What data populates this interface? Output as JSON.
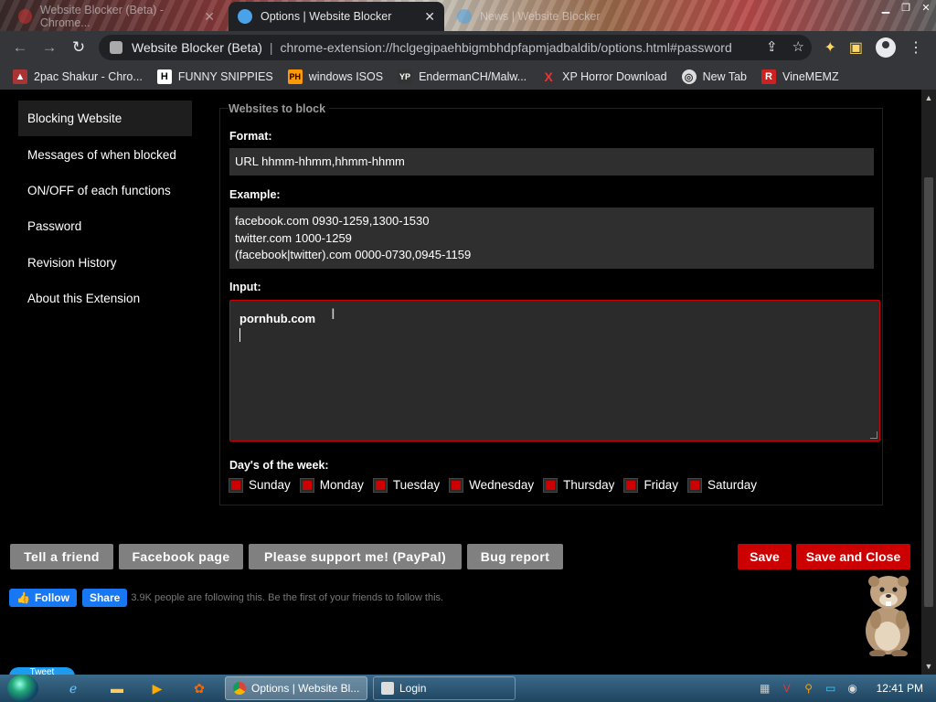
{
  "browser": {
    "tabs": [
      {
        "title": "Website Blocker (Beta) - Chrome...",
        "active": false
      },
      {
        "title": "Options | Website Blocker",
        "active": true
      },
      {
        "title": "News | Website Blocker",
        "active": false
      }
    ],
    "omnibox": {
      "site_name": "Website Blocker (Beta)",
      "separator": "|",
      "url": "chrome-extension://hclgegipaehbigmbhdpfapmjadbaldib/options.html#password"
    },
    "bookmarks": [
      {
        "label": "2pac Shakur - Chro...",
        "icon": "2pac-icon"
      },
      {
        "label": "FUNNY SNIPPIES",
        "icon": "H"
      },
      {
        "label": "windows ISOS",
        "icon": "PH"
      },
      {
        "label": "EndermanCH/Malw...",
        "icon": "YP"
      },
      {
        "label": "XP Horror Download",
        "icon": "X"
      },
      {
        "label": "New Tab",
        "icon": "globe-icon"
      },
      {
        "label": "VineMEMZ",
        "icon": "R"
      }
    ]
  },
  "sidebar": {
    "items": [
      {
        "label": "Blocking Website",
        "active": true
      },
      {
        "label": "Messages of when blocked"
      },
      {
        "label": "ON/OFF of each functions"
      },
      {
        "label": "Password"
      },
      {
        "label": "Revision History"
      },
      {
        "label": "About this Extension"
      }
    ]
  },
  "form": {
    "legend": "Websites to block",
    "format_label": "Format:",
    "format_value": "URL hhmm-hhmm,hhmm-hhmm",
    "example_label": "Example:",
    "example_lines": [
      "facebook.com 0930-1259,1300-1530",
      "twitter.com 1000-1259",
      "(facebook|twitter).com 0000-0730,0945-1159"
    ],
    "input_label": "Input:",
    "input_value": "pornhub.com",
    "days_label": "Day's of the week:",
    "days": [
      "Sunday",
      "Monday",
      "Tuesday",
      "Wednesday",
      "Thursday",
      "Friday",
      "Saturday"
    ]
  },
  "buttons": {
    "tell_friend": "Tell a friend",
    "facebook_page": "Facebook page",
    "support": "Please support me! (PayPal)",
    "bug_report": "Bug report",
    "save": "Save",
    "save_close": "Save and Close"
  },
  "social": {
    "follow": "Follow",
    "share": "Share",
    "followers_text": "3.9K people are following this. Be the first of your friends to follow this.",
    "tweet": "Tweet"
  },
  "taskbar": {
    "tasks": [
      {
        "label": "Options | Website Bl...",
        "active": true
      },
      {
        "label": "Login",
        "active": false
      }
    ],
    "clock": "12:41 PM"
  },
  "colors": {
    "accent_red": "#cc0000",
    "button_gray": "#808080",
    "facebook_blue": "#1877f2"
  }
}
